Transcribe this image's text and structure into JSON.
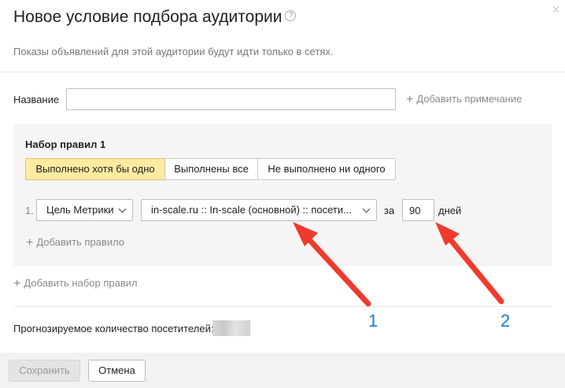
{
  "dialog": {
    "title": "Новое условие подбора аудитории",
    "help_glyph": "?",
    "close_glyph": "×",
    "subtitle": "Показы объявлений для этой аудитории будут идти только в сетях."
  },
  "name_row": {
    "label": "Название",
    "value": "",
    "add_note": "Добавить примечание"
  },
  "ruleset": {
    "title": "Набор правил 1",
    "tabs": [
      {
        "label": "Выполнено хотя бы одно",
        "active": true
      },
      {
        "label": "Выполнены все",
        "active": false
      },
      {
        "label": "Не выполнено ни одного",
        "active": false
      }
    ],
    "rule": {
      "index": "1.",
      "type": "Цель Метрики",
      "goal": "in-scale.ru :: In-scale (основной) :: посети...",
      "za": "за",
      "days": "90",
      "days_unit": "дней"
    },
    "add_rule": "Добавить правило"
  },
  "add_ruleset": "Добавить набор правил",
  "forecast_label": "Прогнозируемое количество посетителей:",
  "annotations": [
    "1",
    "2"
  ],
  "footer": {
    "save": "Сохранить",
    "cancel": "Отмена"
  },
  "colors": {
    "active_tab": "#ffeba0",
    "ruleset_bg": "#f6f5f3",
    "arrow": "#f03a2e",
    "annotation": "#1a7fc2"
  }
}
